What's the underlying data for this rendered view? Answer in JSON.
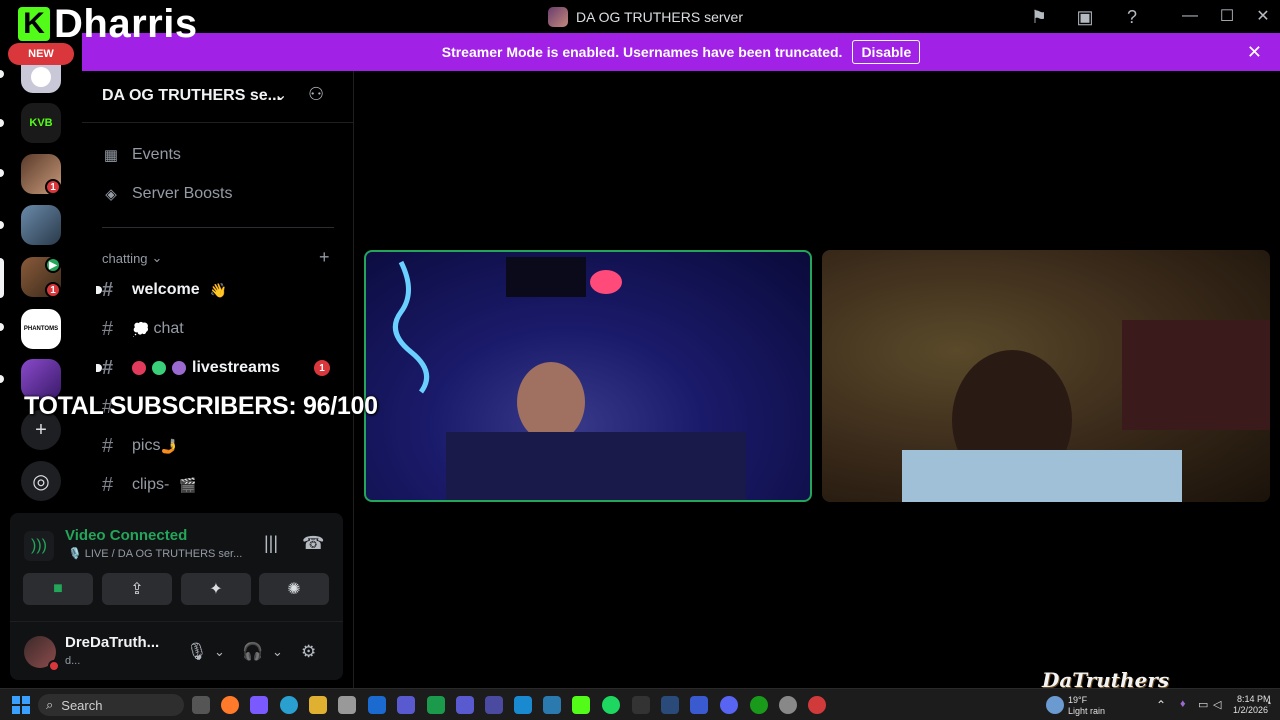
{
  "brand": {
    "logo_letter": "K",
    "name": "Dharris"
  },
  "window": {
    "title": "DA OG TRUTHERS server"
  },
  "banner": {
    "message": "Streamer Mode is enabled. Usernames have been truncated.",
    "disable_label": "Disable"
  },
  "rail": {
    "new_label": "NEW",
    "servers": [
      {
        "name": "server-1",
        "badge": ""
      },
      {
        "name": "server-kvb",
        "label": "KVB",
        "badge": ""
      },
      {
        "name": "server-3",
        "badge": "1"
      },
      {
        "name": "server-4",
        "badge": ""
      },
      {
        "name": "server-5",
        "badge": "1",
        "sub": "24"
      },
      {
        "name": "server-phantoms",
        "label": "PHANTOMS",
        "badge": ""
      },
      {
        "name": "server-7",
        "badge": ""
      }
    ]
  },
  "sidebar": {
    "server_name": "DA OG TRUTHERS se...",
    "nav": [
      {
        "label": "Events"
      },
      {
        "label": "Server Boosts"
      }
    ],
    "category": "chatting",
    "channels": [
      {
        "name": "welcome",
        "emoji": "👋",
        "unread": true
      },
      {
        "name": "chat",
        "emoji": "💭",
        "unread": false
      },
      {
        "name": "livestreams",
        "unread": true,
        "badge": "1"
      },
      {
        "name": "",
        "unread": false
      },
      {
        "name": "pics",
        "emoji": "🤳",
        "unread": false
      },
      {
        "name": "clips-",
        "emoji": "🎬",
        "unread": false
      }
    ]
  },
  "overlay": {
    "subscribers_text": "TOTAL SUBSCRIBERS: 96/100"
  },
  "voice": {
    "status": "Video Connected",
    "channel": "🎙️ LIVE / DA OG TRUTHERS ser..."
  },
  "user": {
    "name": "DreDaTruth...",
    "status": "d..."
  },
  "watermark": "DaTruthers",
  "taskbar": {
    "search_placeholder": "Search",
    "weather_temp": "19°F",
    "weather_desc": "Light rain",
    "time": "8:14 PM",
    "date": "1/2/2026"
  },
  "colors": {
    "accent": "#a121e6",
    "connected": "#23a55a",
    "badge": "#da373c",
    "kick": "#53fc18"
  }
}
